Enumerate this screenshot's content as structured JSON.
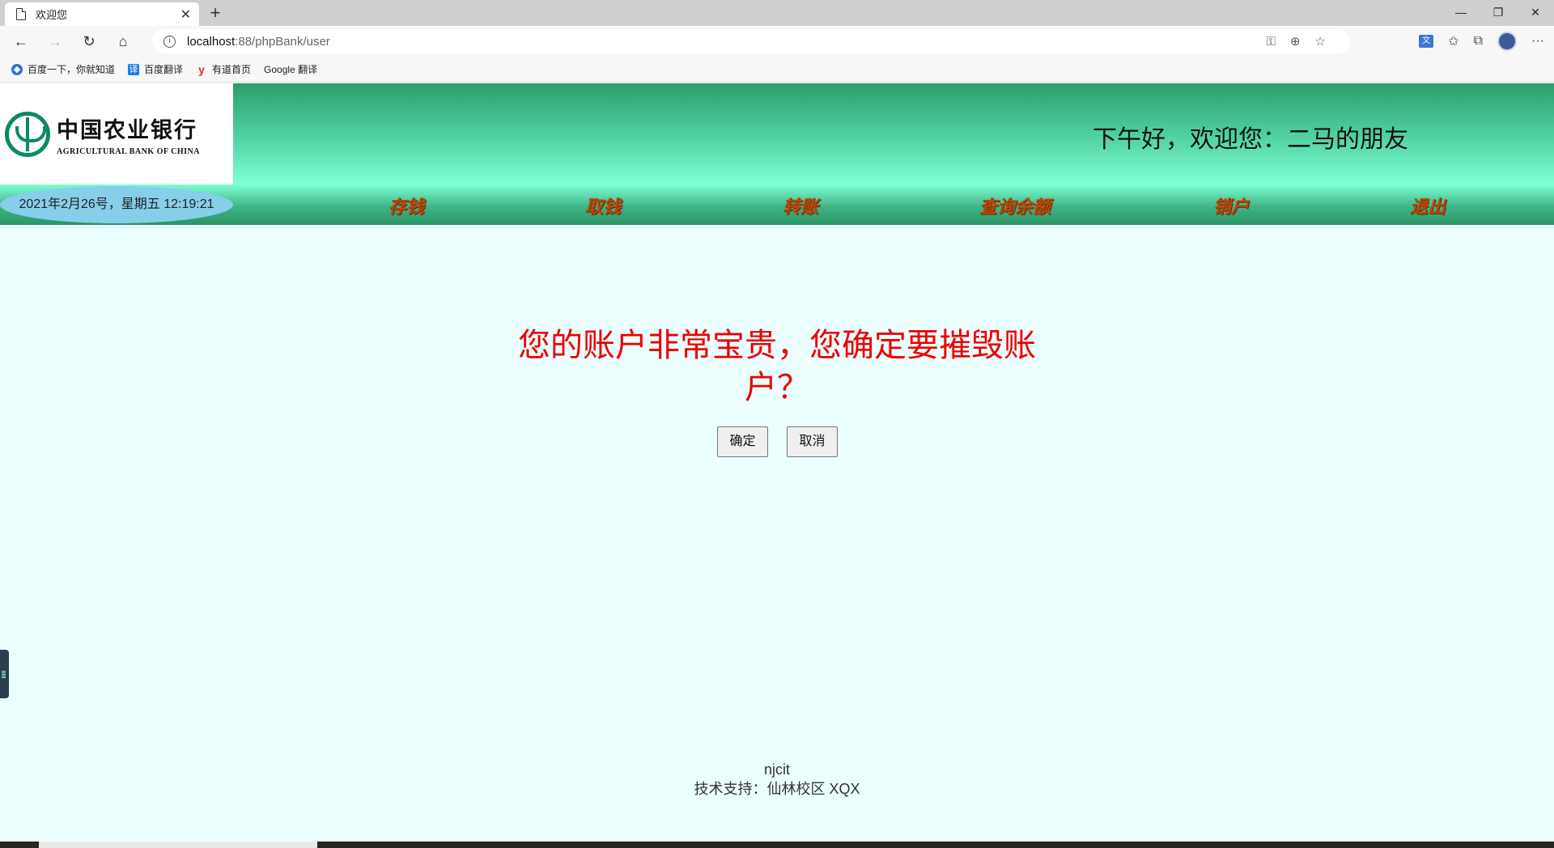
{
  "browser": {
    "tab_title": "欢迎您",
    "tab_close": "✕",
    "new_tab": "+",
    "window_controls": [
      "—",
      "❐",
      "✕"
    ],
    "nav": {
      "back": "←",
      "forward": "→",
      "reload": "↻",
      "home": "⌂"
    },
    "url_host": "localhost",
    "url_rest": ":88/phpBank/user",
    "bookmarks": [
      {
        "icon": "baidu-icon",
        "label": "百度一下，你就知道"
      },
      {
        "icon": "fanyi-icon",
        "label": "百度翻译"
      },
      {
        "icon": "youdao-icon",
        "label": "有道首页"
      },
      {
        "icon": "page-icon",
        "label": "Google 翻译"
      }
    ]
  },
  "bank": {
    "logo_cn": "中国农业银行",
    "logo_en": "AGRICULTURAL BANK OF CHINA",
    "greeting": "下午好，欢迎您：二马的朋友",
    "datetime": "2021年2月26号，星期五 12:19:21",
    "menu": [
      "存钱",
      "取钱",
      "转账",
      "查询余额",
      "销户",
      "退出"
    ],
    "colors": {
      "header_top": "#2e9d6d",
      "header_bottom": "#7fffd4",
      "menu_text": "#b8470b",
      "message": "#ee0000",
      "page_bg": "#ebfffe"
    }
  },
  "dialog": {
    "message": "您的账户非常宝贵，您确定要摧毁账户？",
    "confirm_label": "确定",
    "cancel_label": "取消"
  },
  "footer": {
    "line1": "njcit",
    "line2": "技术支持：仙林校区 XQX"
  }
}
